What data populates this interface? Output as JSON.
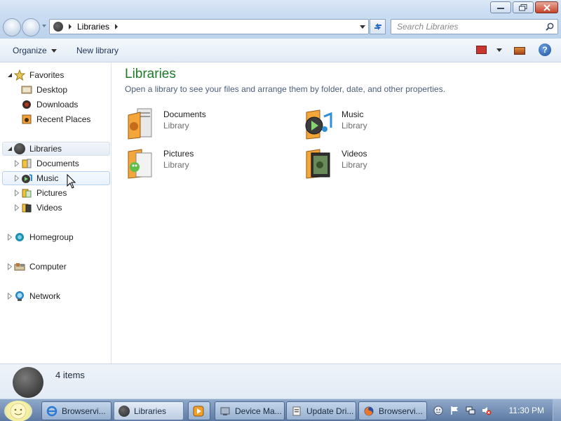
{
  "window": {
    "minimize_label": "Minimize",
    "maximize_label": "Maximize",
    "close_label": "Close"
  },
  "address": {
    "crumb": "Libraries",
    "search_placeholder": "Search Libraries"
  },
  "toolbar": {
    "organize_label": "Organize",
    "new_library_label": "New library",
    "help_label": "?"
  },
  "nav": {
    "favorites": {
      "label": "Favorites",
      "items": [
        {
          "label": "Desktop",
          "icon": "desktop-icon"
        },
        {
          "label": "Downloads",
          "icon": "downloads-icon"
        },
        {
          "label": "Recent Places",
          "icon": "recent-places-icon"
        }
      ]
    },
    "libraries": {
      "label": "Libraries",
      "items": [
        {
          "label": "Documents",
          "icon": "documents-icon"
        },
        {
          "label": "Music",
          "icon": "music-icon"
        },
        {
          "label": "Pictures",
          "icon": "pictures-icon"
        },
        {
          "label": "Videos",
          "icon": "videos-icon"
        }
      ]
    },
    "homegroup": {
      "label": "Homegroup"
    },
    "computer": {
      "label": "Computer"
    },
    "network": {
      "label": "Network"
    }
  },
  "main": {
    "title": "Libraries",
    "subtitle": "Open a library to see your files and arrange them by folder, date, and other properties.",
    "libraries": [
      {
        "name": "Documents",
        "kind": "Library",
        "icon": "documents-library-icon"
      },
      {
        "name": "Music",
        "kind": "Library",
        "icon": "music-library-icon"
      },
      {
        "name": "Pictures",
        "kind": "Library",
        "icon": "pictures-library-icon"
      },
      {
        "name": "Videos",
        "kind": "Library",
        "icon": "videos-library-icon"
      }
    ]
  },
  "details": {
    "count": "4 items"
  },
  "taskbar": {
    "buttons": [
      {
        "label": "Browservi...",
        "icon": "ie-icon"
      },
      {
        "label": "Libraries",
        "icon": "libraries-icon"
      },
      {
        "label": "",
        "icon": "media-player-icon"
      },
      {
        "label": "Device Ma...",
        "icon": "device-manager-icon"
      },
      {
        "label": "Update Dri...",
        "icon": "update-driver-icon"
      },
      {
        "label": "Browservi...",
        "icon": "firefox-icon"
      }
    ],
    "clock": "11:30 PM"
  },
  "colors": {
    "title_green": "#1e7a26",
    "subtitle_blue": "#4c607a",
    "taskbar": "#6f8bb2"
  }
}
